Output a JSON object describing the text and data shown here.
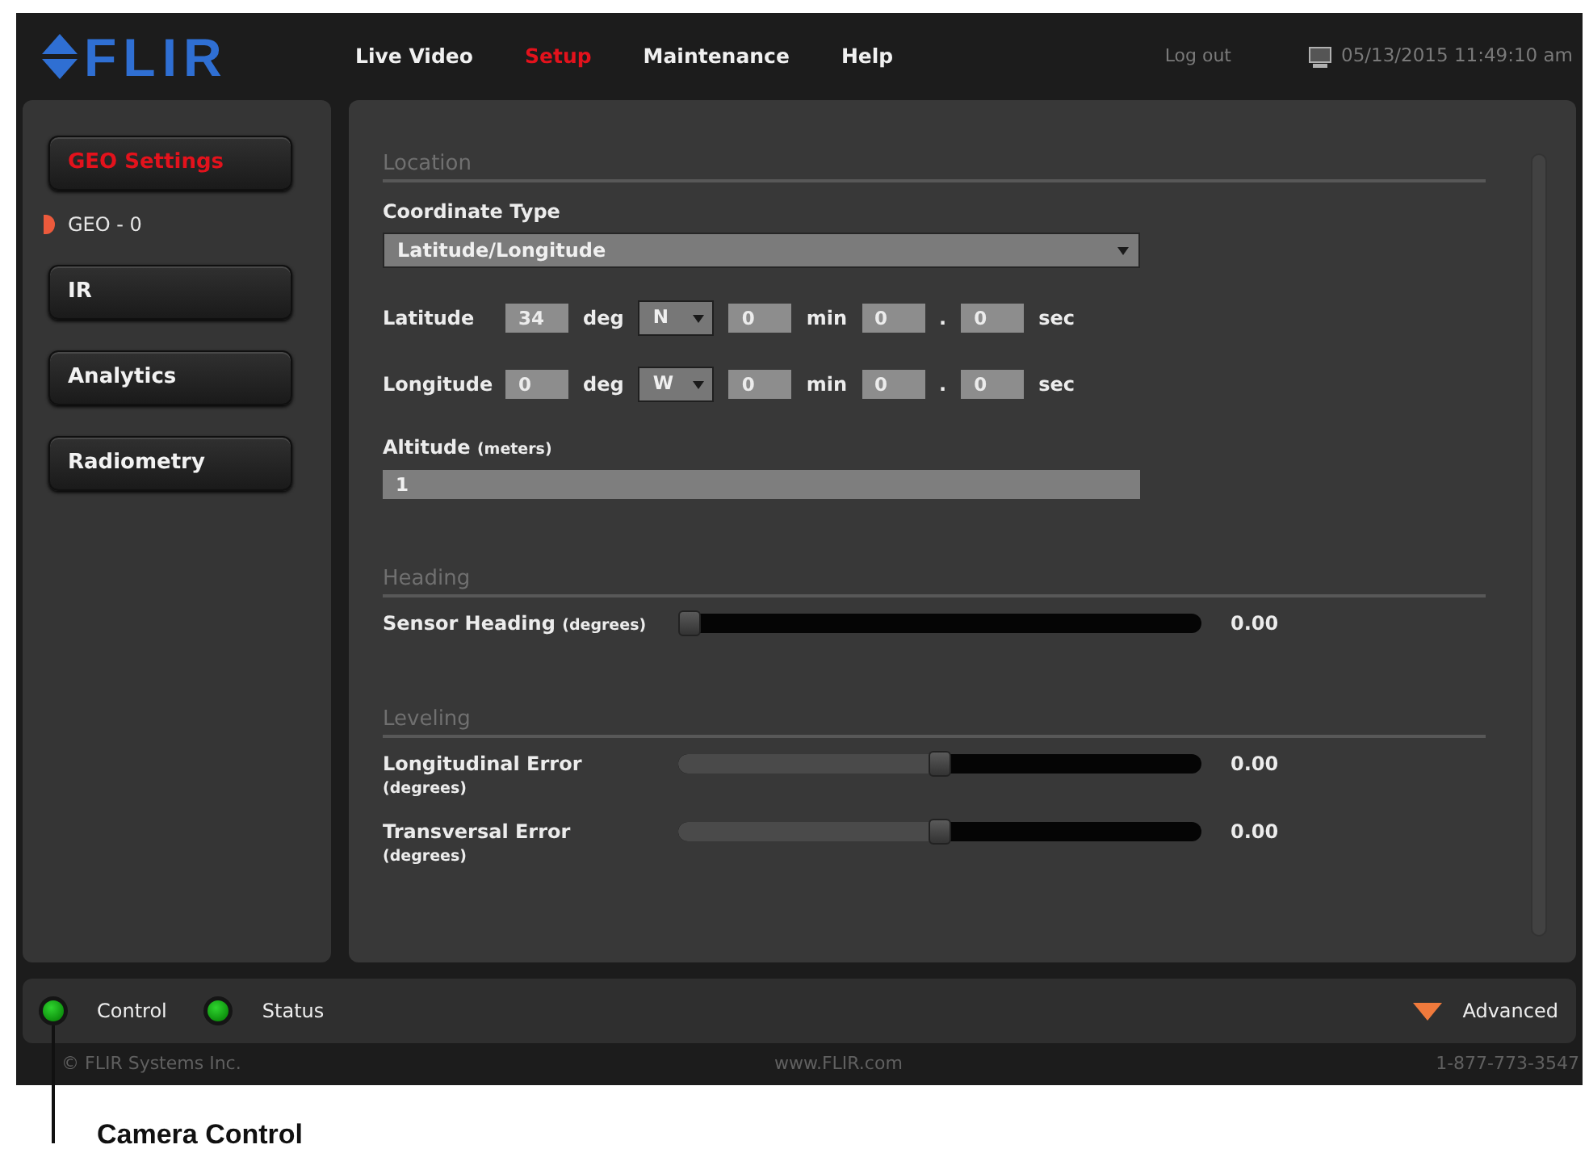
{
  "header": {
    "logo": "FLIR",
    "nav": [
      {
        "label": "Live Video",
        "selected": false
      },
      {
        "label": "Setup",
        "selected": true
      },
      {
        "label": "Maintenance",
        "selected": false
      },
      {
        "label": "Help",
        "selected": false
      }
    ],
    "logout": "Log out",
    "datetime": "05/13/2015 11:49:10 am"
  },
  "sidebar": {
    "items": [
      {
        "kind": "button",
        "label": "GEO Settings",
        "selected": true
      },
      {
        "kind": "subitem",
        "label": "GEO - 0",
        "selected": true
      },
      {
        "kind": "button",
        "label": "IR",
        "selected": false
      },
      {
        "kind": "button",
        "label": "Analytics",
        "selected": false
      },
      {
        "kind": "button",
        "label": "Radiometry",
        "selected": false
      }
    ]
  },
  "sections": [
    {
      "title": "Location",
      "fields": [
        {
          "kind": "select",
          "label": "Coordinate Type",
          "value": "Latitude/Longitude"
        },
        {
          "kind": "coordinate",
          "label": "Latitude",
          "parts": [
            {
              "kind": "input",
              "value": "34"
            },
            {
              "kind": "unit",
              "text": "deg"
            },
            {
              "kind": "select",
              "value": "N"
            },
            {
              "kind": "input",
              "value": "0"
            },
            {
              "kind": "unit",
              "text": "min"
            },
            {
              "kind": "input",
              "value": "0"
            },
            {
              "kind": "unit",
              "text": "."
            },
            {
              "kind": "input",
              "value": "0"
            },
            {
              "kind": "unit",
              "text": "sec"
            }
          ]
        },
        {
          "kind": "coordinate",
          "label": "Longitude",
          "parts": [
            {
              "kind": "input",
              "value": "0"
            },
            {
              "kind": "unit",
              "text": "deg"
            },
            {
              "kind": "select",
              "value": "W"
            },
            {
              "kind": "input",
              "value": "0"
            },
            {
              "kind": "unit",
              "text": "min"
            },
            {
              "kind": "input",
              "value": "0"
            },
            {
              "kind": "unit",
              "text": "."
            },
            {
              "kind": "input",
              "value": "0"
            },
            {
              "kind": "unit",
              "text": "sec"
            }
          ]
        },
        {
          "kind": "text",
          "label": "Altitude",
          "unit": "(meters)",
          "value": "1"
        }
      ]
    },
    {
      "title": "Heading",
      "fields": [
        {
          "kind": "slider",
          "label": "Sensor Heading",
          "unit": "(degrees)",
          "unit_below": false,
          "level": 0,
          "reading": "0.00"
        }
      ]
    },
    {
      "title": "Leveling",
      "fields": [
        {
          "kind": "slider",
          "label": "Longitudinal Error",
          "unit": "(degrees)",
          "unit_below": true,
          "level": 0.5,
          "reading": "0.00"
        },
        {
          "kind": "slider",
          "label": "Transversal Error",
          "unit": "(degrees)",
          "unit_below": true,
          "level": 0.5,
          "reading": "0.00"
        }
      ]
    }
  ],
  "status_bar": {
    "indicators": [
      {
        "label": "Control",
        "on": true
      },
      {
        "label": "Status",
        "on": true
      }
    ],
    "advanced": "Advanced"
  },
  "footer": {
    "copyright": "© FLIR Systems Inc.",
    "website": "www.FLIR.com",
    "phone": "1-877-773-3547"
  },
  "callout": {
    "text": "Camera Control"
  }
}
